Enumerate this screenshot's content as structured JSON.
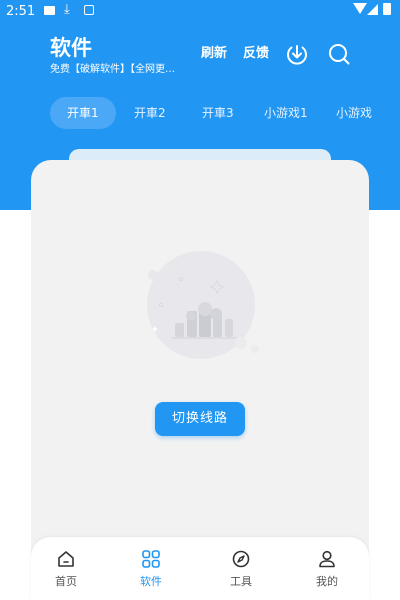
{
  "status_bar": {
    "time": "2:51"
  },
  "header": {
    "title": "软件",
    "subtitle": "免费【破解软件】【全网更…",
    "refresh_label": "刷新",
    "feedback_label": "反馈"
  },
  "tabs": [
    {
      "label": "开車1",
      "active": true
    },
    {
      "label": "开車2"
    },
    {
      "label": "开車3"
    },
    {
      "label": "小游戏1"
    },
    {
      "label": "小游戏"
    }
  ],
  "content": {
    "switch_button_label": "切换线路"
  },
  "bottom_nav": {
    "items": [
      {
        "label": "首页",
        "icon": "home-icon"
      },
      {
        "label": "软件",
        "icon": "apps-icon",
        "active": true
      },
      {
        "label": "工具",
        "icon": "compass-icon"
      },
      {
        "label": "我的",
        "icon": "user-icon"
      }
    ]
  },
  "colors": {
    "primary": "#2196F3",
    "tab_active_bg": "#4AA8F7",
    "content_bg": "#f2f2f2"
  }
}
